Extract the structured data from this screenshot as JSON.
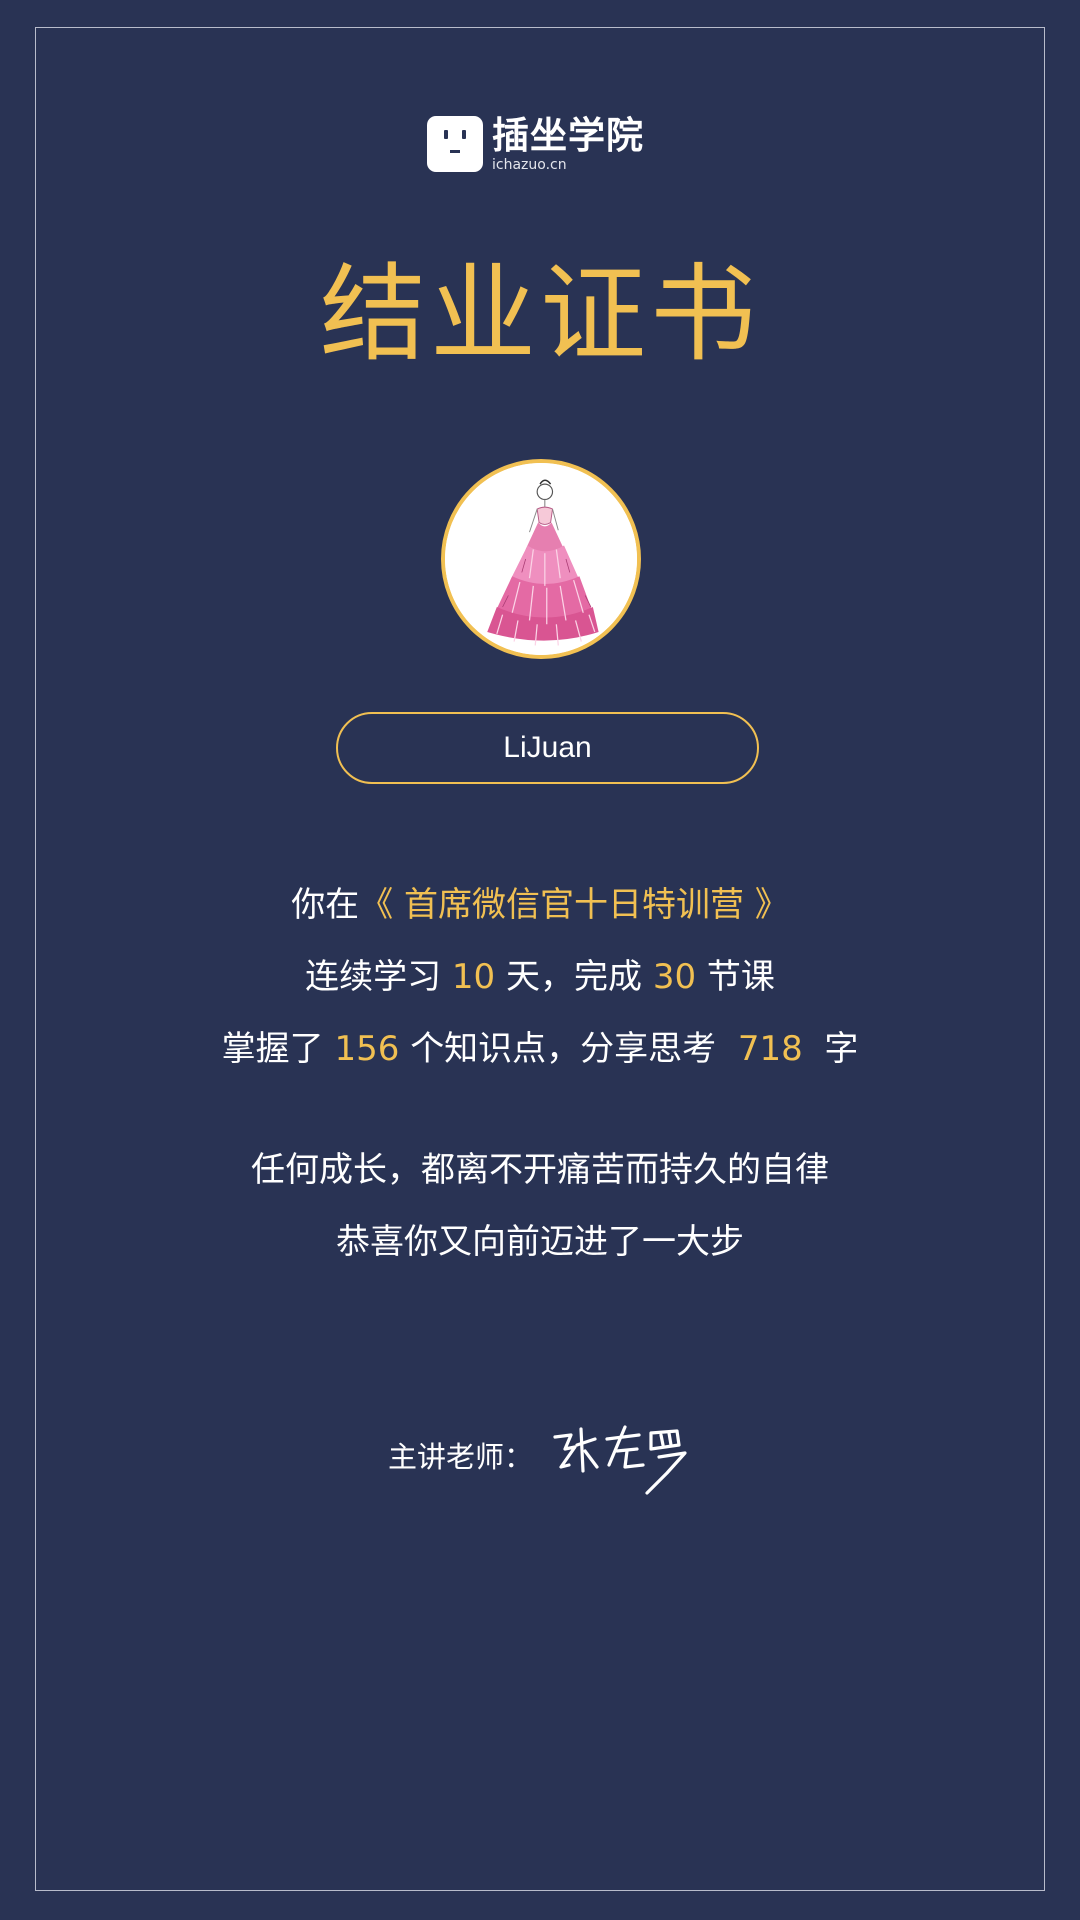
{
  "logo": {
    "name": "插坐学院",
    "domain": "ichazuo.cn"
  },
  "certificate": {
    "title": "结业证书",
    "student_name": "LiJuan"
  },
  "summary": {
    "line1_prefix": "你在",
    "course": "《 首席微信官十日特训营 》",
    "line2_a": "连续学习",
    "days": "10",
    "line2_b": "天，完成",
    "lessons": "30",
    "line2_c": "节课",
    "line3_a": "掌握了",
    "knowledge_points": "156",
    "line3_b": "个知识点，分享思考",
    "words": "718",
    "line3_c": "字"
  },
  "motto": {
    "line1": "任何成长，都离不开痛苦而持久的自律",
    "line2": "恭喜你又向前迈进了一大步"
  },
  "teacher": {
    "label": "主讲老师：",
    "signature": "张左罗"
  },
  "colors": {
    "background": "#293354",
    "accent": "#f1c052",
    "text": "#ffffff"
  }
}
